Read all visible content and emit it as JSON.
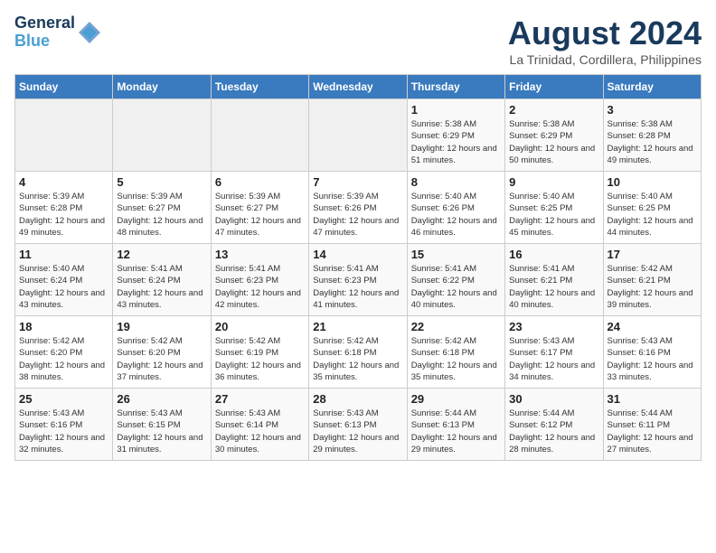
{
  "header": {
    "logo_line1": "General",
    "logo_line2": "Blue",
    "title": "August 2024",
    "subtitle": "La Trinidad, Cordillera, Philippines"
  },
  "weekdays": [
    "Sunday",
    "Monday",
    "Tuesday",
    "Wednesday",
    "Thursday",
    "Friday",
    "Saturday"
  ],
  "weeks": [
    [
      {
        "day": "",
        "empty": true
      },
      {
        "day": "",
        "empty": true
      },
      {
        "day": "",
        "empty": true
      },
      {
        "day": "",
        "empty": true
      },
      {
        "day": "1",
        "sunrise": "5:38 AM",
        "sunset": "6:29 PM",
        "daylight": "12 hours and 51 minutes."
      },
      {
        "day": "2",
        "sunrise": "5:38 AM",
        "sunset": "6:29 PM",
        "daylight": "12 hours and 50 minutes."
      },
      {
        "day": "3",
        "sunrise": "5:38 AM",
        "sunset": "6:28 PM",
        "daylight": "12 hours and 49 minutes."
      }
    ],
    [
      {
        "day": "4",
        "sunrise": "5:39 AM",
        "sunset": "6:28 PM",
        "daylight": "12 hours and 49 minutes."
      },
      {
        "day": "5",
        "sunrise": "5:39 AM",
        "sunset": "6:27 PM",
        "daylight": "12 hours and 48 minutes."
      },
      {
        "day": "6",
        "sunrise": "5:39 AM",
        "sunset": "6:27 PM",
        "daylight": "12 hours and 47 minutes."
      },
      {
        "day": "7",
        "sunrise": "5:39 AM",
        "sunset": "6:26 PM",
        "daylight": "12 hours and 47 minutes."
      },
      {
        "day": "8",
        "sunrise": "5:40 AM",
        "sunset": "6:26 PM",
        "daylight": "12 hours and 46 minutes."
      },
      {
        "day": "9",
        "sunrise": "5:40 AM",
        "sunset": "6:25 PM",
        "daylight": "12 hours and 45 minutes."
      },
      {
        "day": "10",
        "sunrise": "5:40 AM",
        "sunset": "6:25 PM",
        "daylight": "12 hours and 44 minutes."
      }
    ],
    [
      {
        "day": "11",
        "sunrise": "5:40 AM",
        "sunset": "6:24 PM",
        "daylight": "12 hours and 43 minutes."
      },
      {
        "day": "12",
        "sunrise": "5:41 AM",
        "sunset": "6:24 PM",
        "daylight": "12 hours and 43 minutes."
      },
      {
        "day": "13",
        "sunrise": "5:41 AM",
        "sunset": "6:23 PM",
        "daylight": "12 hours and 42 minutes."
      },
      {
        "day": "14",
        "sunrise": "5:41 AM",
        "sunset": "6:23 PM",
        "daylight": "12 hours and 41 minutes."
      },
      {
        "day": "15",
        "sunrise": "5:41 AM",
        "sunset": "6:22 PM",
        "daylight": "12 hours and 40 minutes."
      },
      {
        "day": "16",
        "sunrise": "5:41 AM",
        "sunset": "6:21 PM",
        "daylight": "12 hours and 40 minutes."
      },
      {
        "day": "17",
        "sunrise": "5:42 AM",
        "sunset": "6:21 PM",
        "daylight": "12 hours and 39 minutes."
      }
    ],
    [
      {
        "day": "18",
        "sunrise": "5:42 AM",
        "sunset": "6:20 PM",
        "daylight": "12 hours and 38 minutes."
      },
      {
        "day": "19",
        "sunrise": "5:42 AM",
        "sunset": "6:20 PM",
        "daylight": "12 hours and 37 minutes."
      },
      {
        "day": "20",
        "sunrise": "5:42 AM",
        "sunset": "6:19 PM",
        "daylight": "12 hours and 36 minutes."
      },
      {
        "day": "21",
        "sunrise": "5:42 AM",
        "sunset": "6:18 PM",
        "daylight": "12 hours and 35 minutes."
      },
      {
        "day": "22",
        "sunrise": "5:42 AM",
        "sunset": "6:18 PM",
        "daylight": "12 hours and 35 minutes."
      },
      {
        "day": "23",
        "sunrise": "5:43 AM",
        "sunset": "6:17 PM",
        "daylight": "12 hours and 34 minutes."
      },
      {
        "day": "24",
        "sunrise": "5:43 AM",
        "sunset": "6:16 PM",
        "daylight": "12 hours and 33 minutes."
      }
    ],
    [
      {
        "day": "25",
        "sunrise": "5:43 AM",
        "sunset": "6:16 PM",
        "daylight": "12 hours and 32 minutes."
      },
      {
        "day": "26",
        "sunrise": "5:43 AM",
        "sunset": "6:15 PM",
        "daylight": "12 hours and 31 minutes."
      },
      {
        "day": "27",
        "sunrise": "5:43 AM",
        "sunset": "6:14 PM",
        "daylight": "12 hours and 30 minutes."
      },
      {
        "day": "28",
        "sunrise": "5:43 AM",
        "sunset": "6:13 PM",
        "daylight": "12 hours and 29 minutes."
      },
      {
        "day": "29",
        "sunrise": "5:44 AM",
        "sunset": "6:13 PM",
        "daylight": "12 hours and 29 minutes."
      },
      {
        "day": "30",
        "sunrise": "5:44 AM",
        "sunset": "6:12 PM",
        "daylight": "12 hours and 28 minutes."
      },
      {
        "day": "31",
        "sunrise": "5:44 AM",
        "sunset": "6:11 PM",
        "daylight": "12 hours and 27 minutes."
      }
    ]
  ]
}
